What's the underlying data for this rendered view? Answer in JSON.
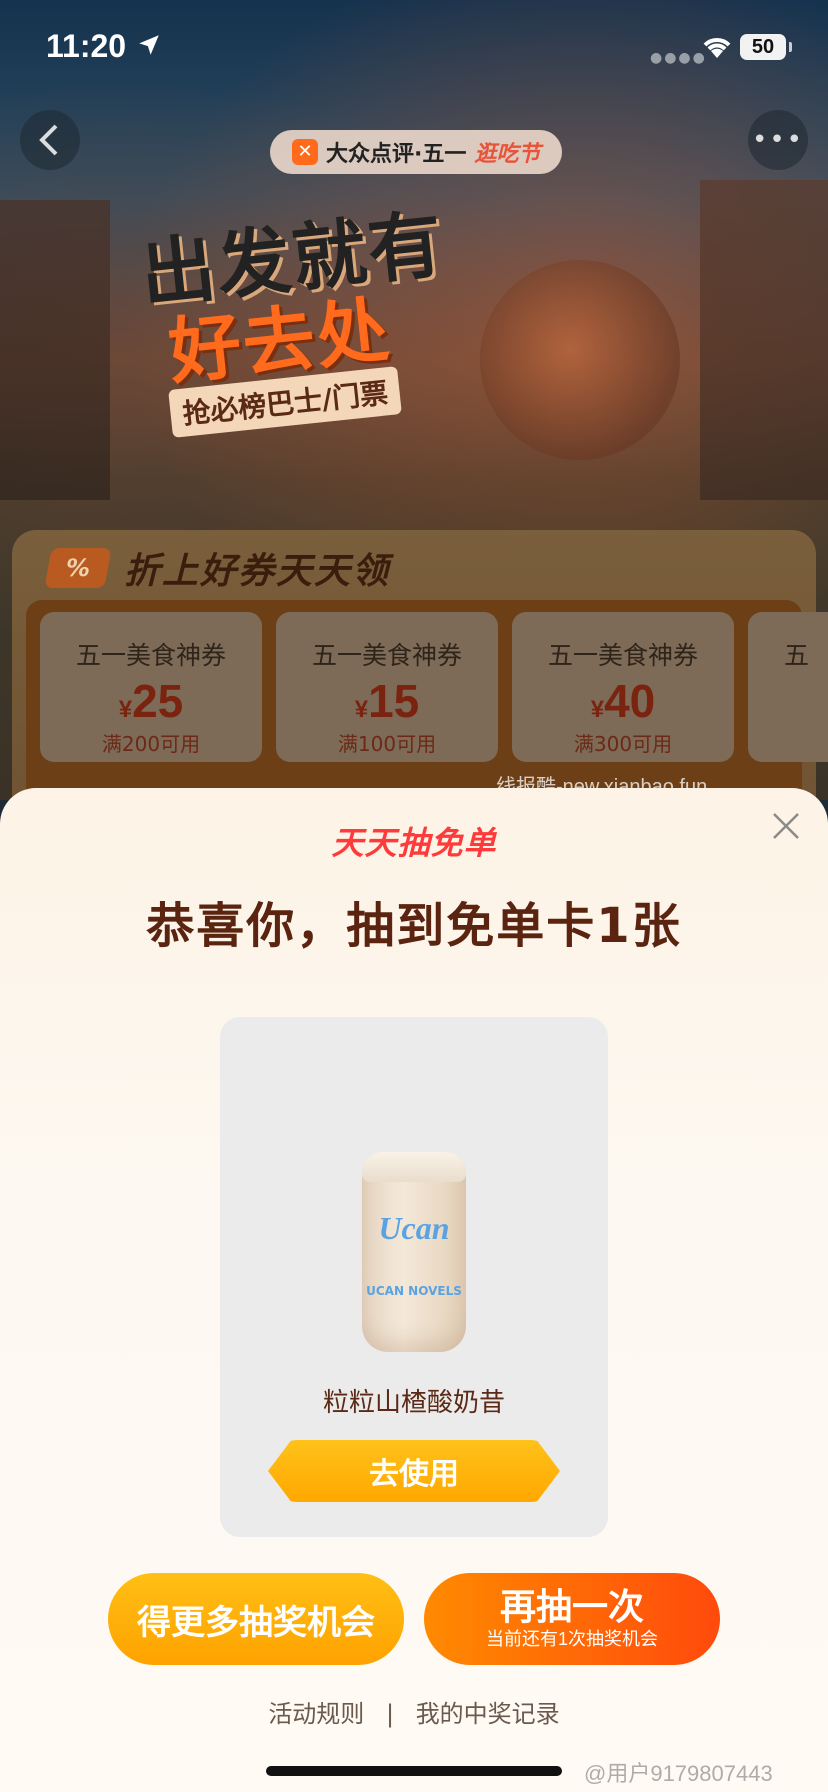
{
  "status_bar": {
    "time": "11:20",
    "battery": "50"
  },
  "header": {
    "brand": "大众点评·五一",
    "fest": "逛吃节"
  },
  "hero": {
    "line1": "出发就有",
    "line2": "好去处",
    "line3": "抢必榜巴士/门票"
  },
  "coupons": {
    "section_title": "折上好券天天领",
    "badge": "%",
    "items": [
      {
        "name": "五一美食神券",
        "currency": "¥",
        "amount": "25",
        "condition": "满200可用"
      },
      {
        "name": "五一美食神券",
        "currency": "¥",
        "amount": "15",
        "condition": "满100可用"
      },
      {
        "name": "五一美食神券",
        "currency": "¥",
        "amount": "40",
        "condition": "满300可用"
      }
    ],
    "partial_name": "五"
  },
  "watermark_top": "线报酷-new.xianbao.fun",
  "modal": {
    "brand": "天天抽免单",
    "title": "恭喜你，抽到免单卡1张",
    "prize": {
      "can_logo": "Ucan",
      "can_sub": "UCAN NOVELS",
      "name": "粒粒山楂酸奶昔",
      "use_label": "去使用"
    },
    "more_chances_label": "得更多抽奖机会",
    "again_label": "再抽一次",
    "again_sub": "当前还有1次抽奖机会",
    "rules_link": "活动规则",
    "separator": "|",
    "records_link": "我的中奖记录"
  },
  "watermark_bottom": "@用户9179807443",
  "colors": {
    "accent_orange": "#ff7a00",
    "title_brown": "#5a2410",
    "brand_red": "#ff3a3a"
  }
}
